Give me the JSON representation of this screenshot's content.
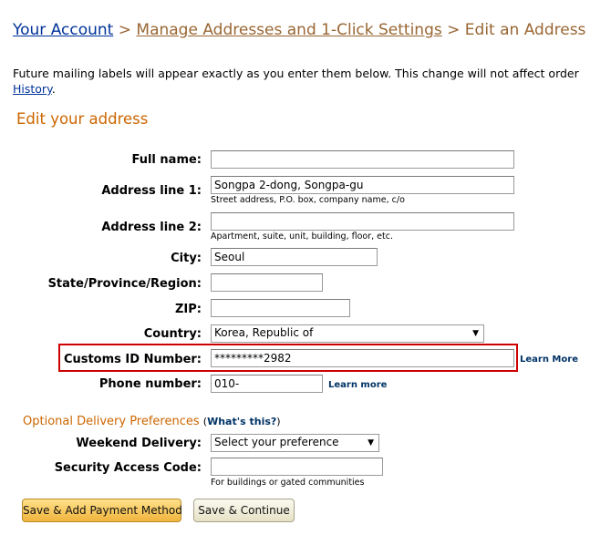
{
  "breadcrumb": {
    "account": "Your Account",
    "sep1": ">",
    "manage": "Manage Addresses and 1-Click Settings",
    "sep2": ">",
    "current": "Edit an Address"
  },
  "intro": {
    "text": "Future mailing labels will appear exactly as you enter them below. This change will not affect order",
    "history_link": "History",
    "period": "."
  },
  "section_title": "Edit your address",
  "form": {
    "full_name": {
      "label": "Full name:",
      "value": "            "
    },
    "address1": {
      "label": "Address line 1:",
      "value": "Songpa 2-dong, Songpa-gu",
      "hint": "Street address, P.O. box, company name, c/o"
    },
    "address2": {
      "label": "Address line 2:",
      "value": "                        ",
      "hint": "Apartment, suite, unit, building, floor, etc."
    },
    "city": {
      "label": "City:",
      "value": "Seoul"
    },
    "state": {
      "label": "State/Province/Region:",
      "value": ""
    },
    "zip": {
      "label": "ZIP:",
      "value": ""
    },
    "country": {
      "label": "Country:",
      "value": "Korea, Republic of"
    },
    "customs_id": {
      "label": "Customs ID Number:",
      "value": "*********2982",
      "learn_more": "Learn More"
    },
    "phone": {
      "label": "Phone number:",
      "value": "010-",
      "learn_more": "Learn more"
    }
  },
  "optional": {
    "title": "Optional Delivery Preferences",
    "paren_open": "(",
    "whats_this": "What's this?",
    "paren_close": ")",
    "weekend": {
      "label": "Weekend Delivery:",
      "value": "Select your preference"
    },
    "security": {
      "label": "Security Access Code:",
      "value": "",
      "hint": "For buildings or gated communities"
    }
  },
  "buttons": {
    "add_payment": "Save & Add Payment Method",
    "save_continue": "Save & Continue"
  },
  "colors": {
    "link": "#003399",
    "accent_orange": "#cc6600",
    "highlight_red": "#cc0000"
  }
}
